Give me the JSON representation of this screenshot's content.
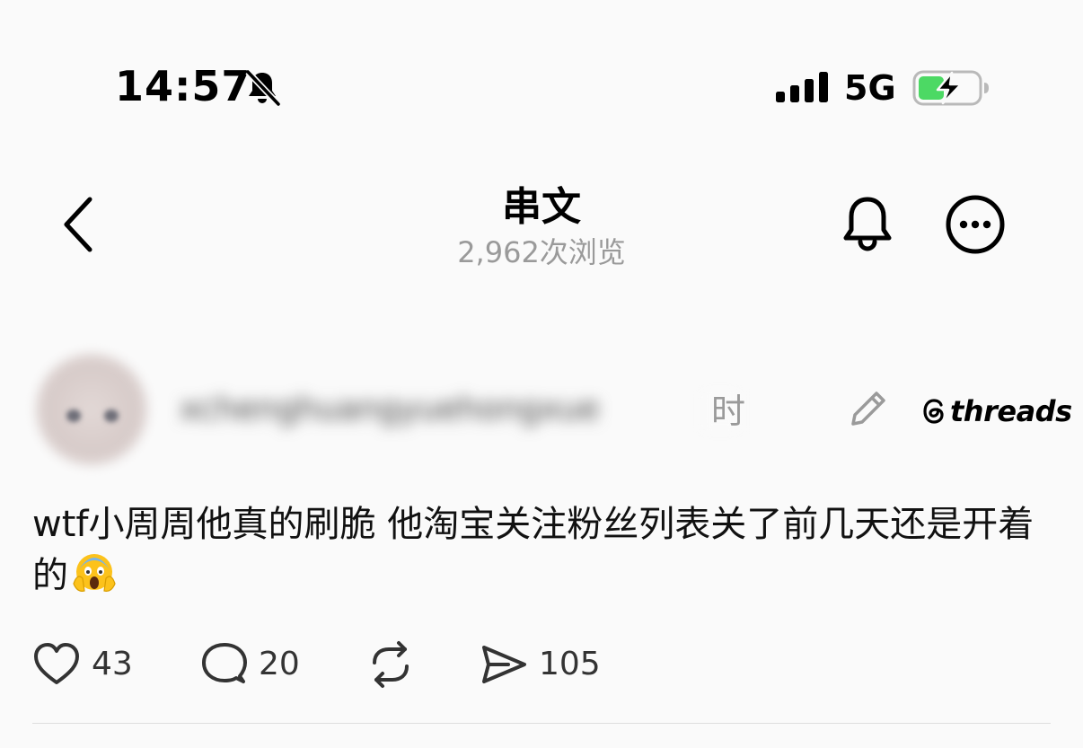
{
  "status_bar": {
    "time": "14:57",
    "network": "5G"
  },
  "header": {
    "title": "串文",
    "views": "2,962次浏览"
  },
  "post": {
    "username": "xchenghuangyuehongxue",
    "time_suffix": "时",
    "brand": "threads",
    "text": "wtf小周周他真的刷脆 他淘宝关注粉丝列表关了前几天还是开着的",
    "likes": "43",
    "replies": "20",
    "shares": "105"
  },
  "colors": {
    "background": "#fafafa",
    "battery_green": "#4cd964",
    "secondary_text": "#9a9a9a"
  }
}
